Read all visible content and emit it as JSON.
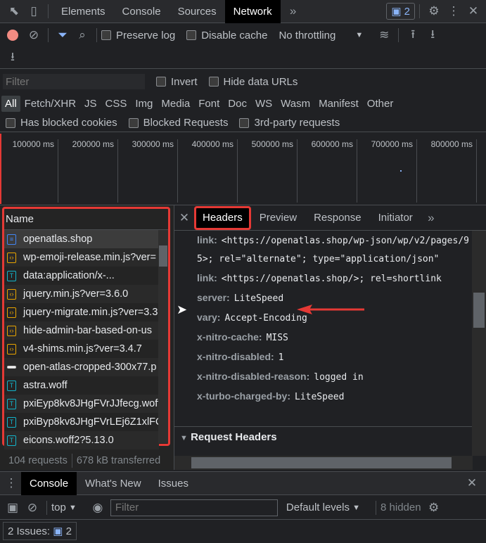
{
  "tabs": {
    "items": [
      "Elements",
      "Console",
      "Sources",
      "Network"
    ],
    "active": "Network",
    "issues_count": "2"
  },
  "toolbar": {
    "preserve_log": "Preserve log",
    "disable_cache": "Disable cache",
    "throttling": "No throttling"
  },
  "filter": {
    "placeholder": "Filter",
    "invert": "Invert",
    "hide_data_urls": "Hide data URLs"
  },
  "types": [
    "All",
    "Fetch/XHR",
    "JS",
    "CSS",
    "Img",
    "Media",
    "Font",
    "Doc",
    "WS",
    "Wasm",
    "Manifest",
    "Other"
  ],
  "checks": [
    "Has blocked cookies",
    "Blocked Requests",
    "3rd-party requests"
  ],
  "timeline": [
    "100000 ms",
    "200000 ms",
    "300000 ms",
    "400000 ms",
    "500000 ms",
    "600000 ms",
    "700000 ms",
    "800000 ms"
  ],
  "names": {
    "header": "Name",
    "items": [
      {
        "name": "openatlas.shop",
        "type": "doc"
      },
      {
        "name": "wp-emoji-release.min.js?ver=",
        "type": "js"
      },
      {
        "name": "data:application/x-...",
        "type": "font"
      },
      {
        "name": "jquery.min.js?ver=3.6.0",
        "type": "js"
      },
      {
        "name": "jquery-migrate.min.js?ver=3.3",
        "type": "js"
      },
      {
        "name": "hide-admin-bar-based-on-us",
        "type": "js"
      },
      {
        "name": "v4-shims.min.js?ver=3.4.7",
        "type": "js"
      },
      {
        "name": "open-atlas-cropped-300x77.p",
        "type": "img"
      },
      {
        "name": "astra.woff",
        "type": "font"
      },
      {
        "name": "pxiEyp8kv8JHgFVrJJfecg.woff2",
        "type": "font"
      },
      {
        "name": "pxiByp8kv8JHgFVrLEj6Z1xlFQ",
        "type": "font"
      },
      {
        "name": "eicons.woff2?5.13.0",
        "type": "font"
      }
    ]
  },
  "status": {
    "requests": "104 requests",
    "transferred": "678 kB transferred"
  },
  "detail": {
    "tabs": [
      "Headers",
      "Preview",
      "Response",
      "Initiator"
    ],
    "active": "Headers",
    "headers": [
      {
        "k": "link:",
        "v": "<https://openatlas.shop/wp-json/wp/v2/pages/95>; rel=\"alternate\"; type=\"application/json\""
      },
      {
        "k": "link:",
        "v": "<https://openatlas.shop/>; rel=shortlink"
      },
      {
        "k": "server:",
        "v": "LiteSpeed"
      },
      {
        "k": "vary:",
        "v": "Accept-Encoding"
      },
      {
        "k": "x-nitro-cache:",
        "v": "MISS"
      },
      {
        "k": "x-nitro-disabled:",
        "v": "1"
      },
      {
        "k": "x-nitro-disabled-reason:",
        "v": "logged in"
      },
      {
        "k": "x-turbo-charged-by:",
        "v": "LiteSpeed"
      }
    ],
    "request_headers": "Request Headers"
  },
  "drawer": {
    "tabs": [
      "Console",
      "What's New",
      "Issues"
    ],
    "context": "top",
    "filter_placeholder": "Filter",
    "levels": "Default levels",
    "hidden": "8 hidden",
    "issues": "2 Issues:",
    "issues_count": "2"
  },
  "colors": {
    "annotation": "#e53935",
    "accent": "#8ab4f8",
    "record": "#f28b82"
  }
}
